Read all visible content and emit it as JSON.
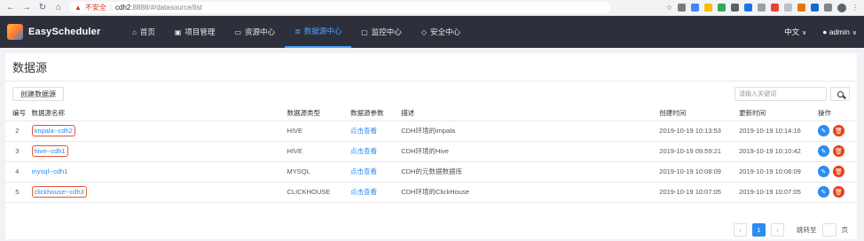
{
  "browser": {
    "warning": "不安全",
    "url_host": "cdh2",
    "url_path": ":8888/#/datasource/list"
  },
  "header": {
    "app_name": "EasyScheduler",
    "nav": [
      {
        "label": "首页",
        "icon": "home-icon",
        "glyph": "⌂"
      },
      {
        "label": "项目管理",
        "icon": "project-icon",
        "glyph": "▣"
      },
      {
        "label": "资源中心",
        "icon": "folder-icon",
        "glyph": "▭"
      },
      {
        "label": "数据源中心",
        "icon": "database-icon",
        "glyph": "≣"
      },
      {
        "label": "监控中心",
        "icon": "monitor-icon",
        "glyph": "▢"
      },
      {
        "label": "安全中心",
        "icon": "shield-icon",
        "glyph": "◇"
      }
    ],
    "active_nav": "数据源中心",
    "language": "中文",
    "user": "admin"
  },
  "page": {
    "title": "数据源",
    "create_button": "创建数据源",
    "search_placeholder": "请输入关键词"
  },
  "table": {
    "columns": [
      "编号",
      "数据源名称",
      "数据源类型",
      "数据源参数",
      "描述",
      "创建时间",
      "更新时间",
      "操作"
    ],
    "rows": [
      {
        "no": "2",
        "name": "impala--cdh2",
        "type": "HIVE",
        "params": "点击查看",
        "desc": "CDH环境的impala",
        "created": "2019-10-19 10:13:53",
        "updated": "2019-10-19 10:14:16",
        "highlight": true
      },
      {
        "no": "3",
        "name": "hive--cdh1",
        "type": "HIVE",
        "params": "点击查看",
        "desc": "CDH环境的Hive",
        "created": "2019-10-19 09:59:21",
        "updated": "2019-10-19 10:10:42",
        "highlight": true
      },
      {
        "no": "4",
        "name": "mysql--cdh1",
        "type": "MYSQL",
        "params": "点击查看",
        "desc": "CDH的元数据数据库",
        "created": "2019-10-19 10:08:09",
        "updated": "2019-10-19 10:08:09",
        "highlight": false
      },
      {
        "no": "5",
        "name": "clickhouse--cdh3",
        "type": "CLICKHOUSE",
        "params": "点击查看",
        "desc": "CDH环境的ClickHouse",
        "created": "2019-10-19 10:07:05",
        "updated": "2019-10-19 10:07:05",
        "highlight": true
      }
    ]
  },
  "pager": {
    "current": "1",
    "jump_label": "跳转至",
    "page_unit": "页"
  },
  "colors": {
    "header_bg": "#2d303a",
    "accent": "#2d8cf0",
    "delete": "#ed4014",
    "highlight_box": "#e4572e"
  }
}
